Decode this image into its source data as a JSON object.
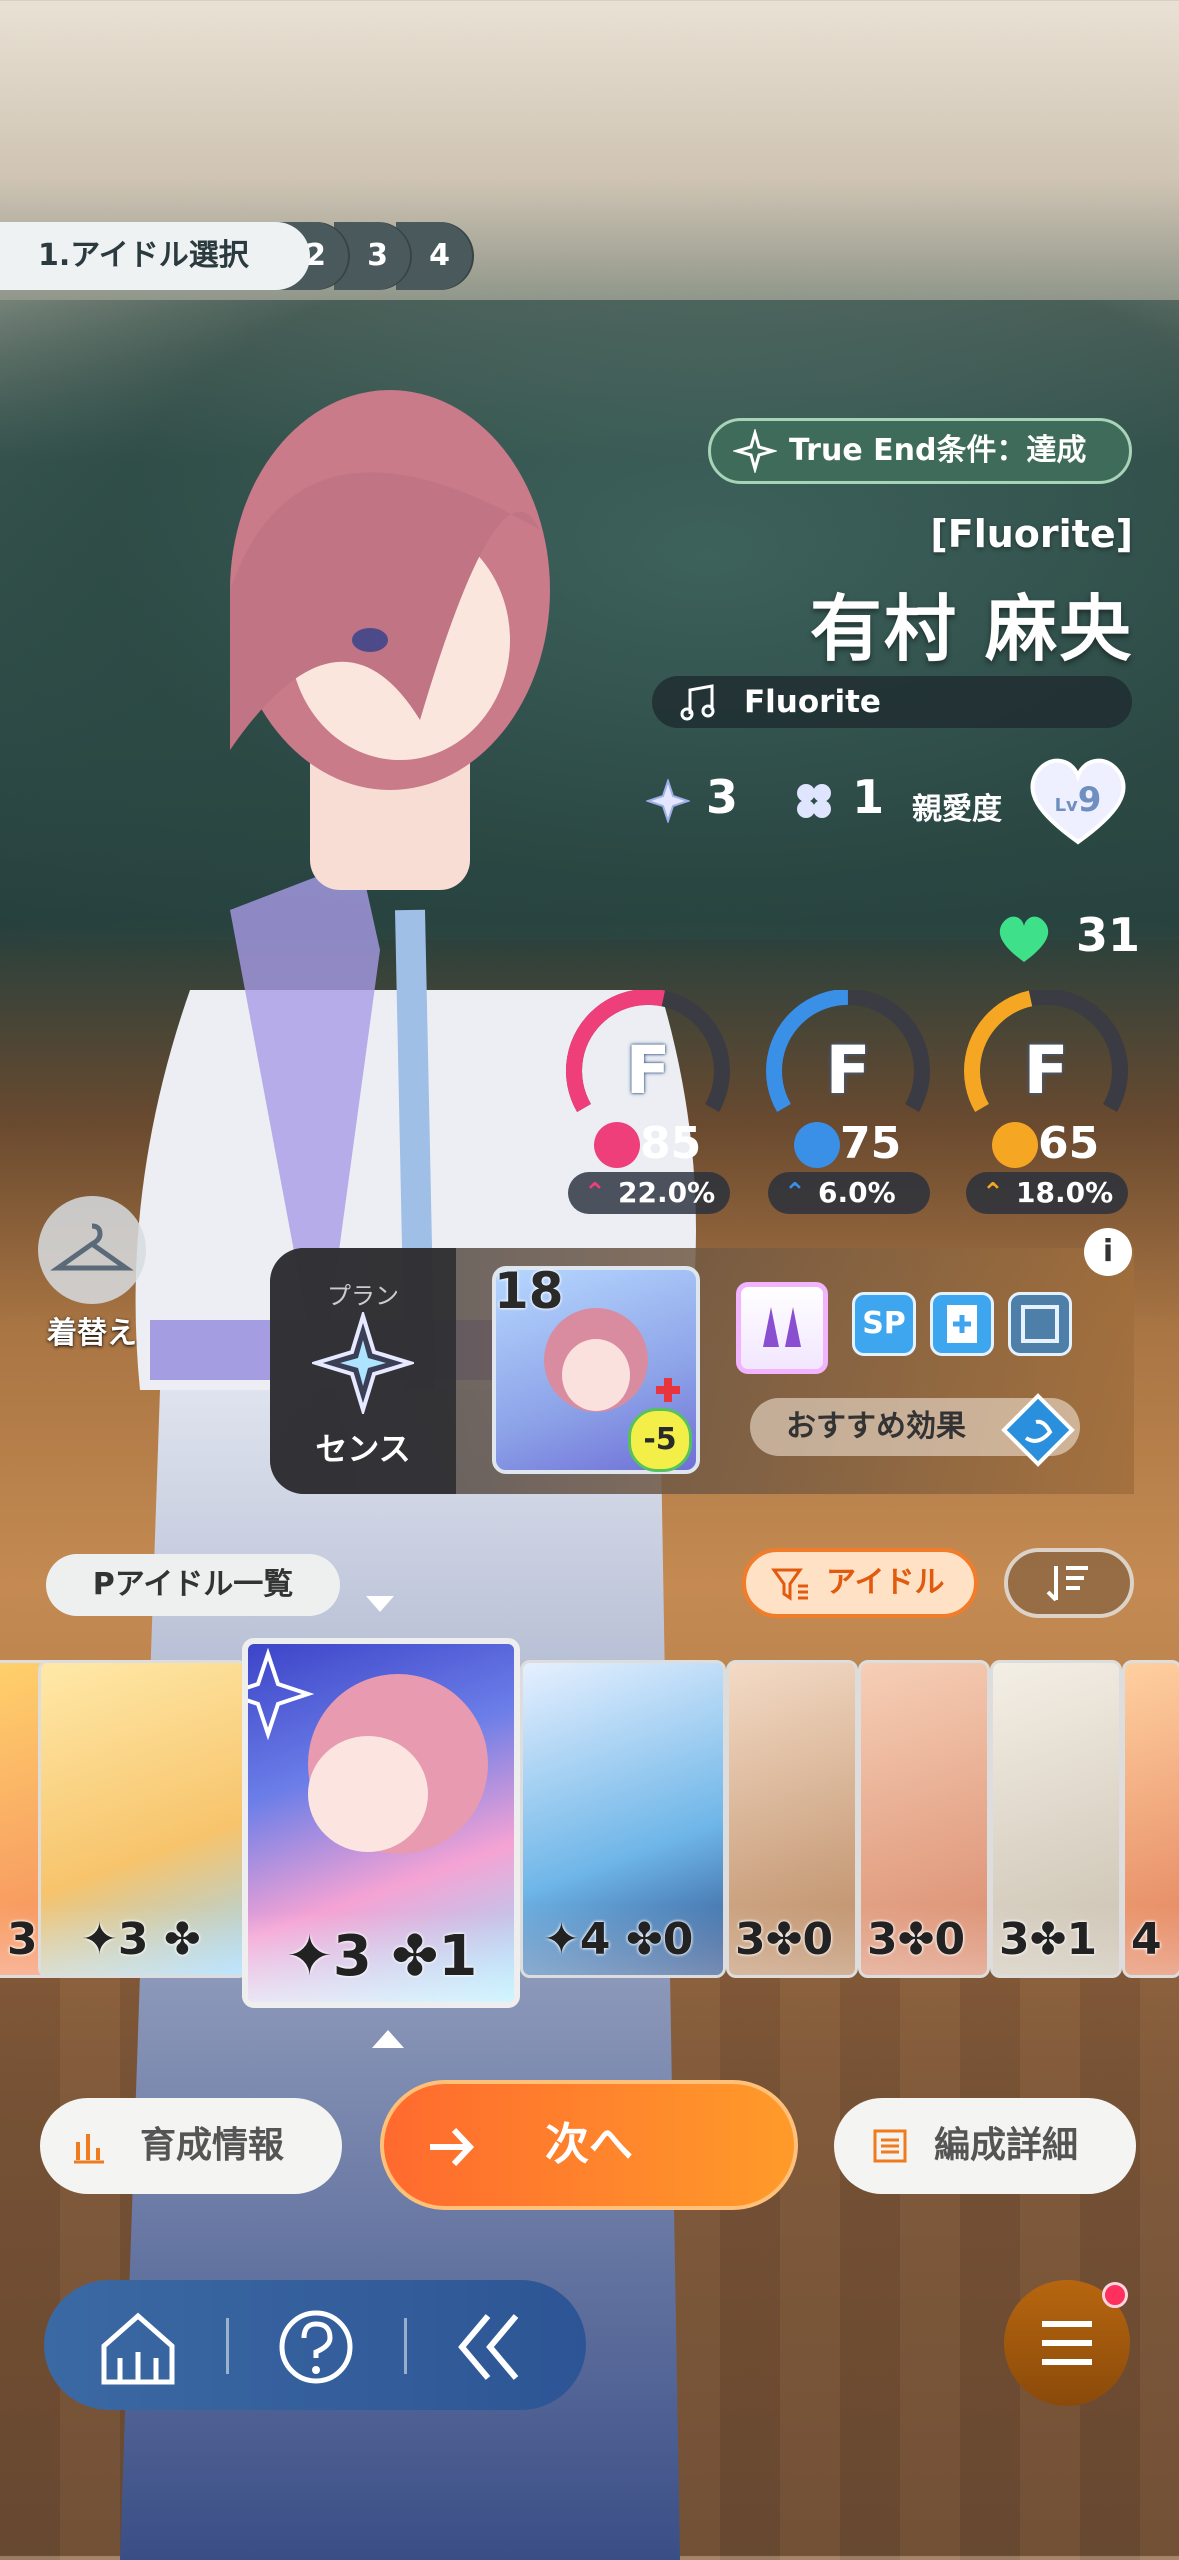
{
  "steps": {
    "active_label": "1.アイドル選択",
    "others": [
      "2",
      "3",
      "4"
    ]
  },
  "true_end": {
    "label": "True End条件：達成",
    "icon": "sparkle-icon"
  },
  "idol": {
    "subtitle": "[Fluorite]",
    "name": "有村 麻央",
    "song": "Fluorite",
    "stars": "3",
    "clover": "1",
    "affection_label": "親愛度",
    "affection_lv_prefix": "Lv",
    "affection_level": "9",
    "hearts": "31"
  },
  "stats": [
    {
      "grade": "F",
      "value": "85",
      "growth": "22.0%",
      "color": "#ee3f7a",
      "icon": "microphone-icon",
      "fill": 0.55
    },
    {
      "grade": "F",
      "value": "75",
      "growth": "6.0%",
      "color": "#3a8fe6",
      "icon": "dance-icon",
      "fill": 0.5
    },
    {
      "grade": "F",
      "value": "65",
      "growth": "18.0%",
      "color": "#f5a623",
      "icon": "visual-icon",
      "fill": 0.45
    }
  ],
  "wardrobe": {
    "label": "着替え",
    "icon": "hanger-icon"
  },
  "plan": {
    "title": "プラン",
    "name": "センス",
    "card_cost": "18",
    "card_delta": "-5",
    "items": [
      "earring-icon",
      "SP",
      "plus-card-icon",
      "search-card-icon"
    ],
    "recommend_label": "おすすめ効果"
  },
  "info_icon": "i",
  "list": {
    "title": "Pアイドル一覧",
    "filter_label": "アイドル",
    "cards": [
      {
        "stars": "3",
        "clover": ""
      },
      {
        "stars": "3",
        "clover": ""
      },
      {
        "stars": "3",
        "clover": "1",
        "selected": true
      },
      {
        "stars": "4",
        "clover": "0"
      },
      {
        "stars": "3",
        "clover": "0"
      },
      {
        "stars": "3",
        "clover": "0"
      },
      {
        "stars": "3",
        "clover": "1"
      },
      {
        "stars": "4",
        "clover": ""
      }
    ]
  },
  "actions": {
    "info": "育成情報",
    "next": "次へ",
    "detail": "編成詳細"
  },
  "nav": [
    "home-icon",
    "help-icon",
    "back-icon",
    "menu-icon"
  ]
}
